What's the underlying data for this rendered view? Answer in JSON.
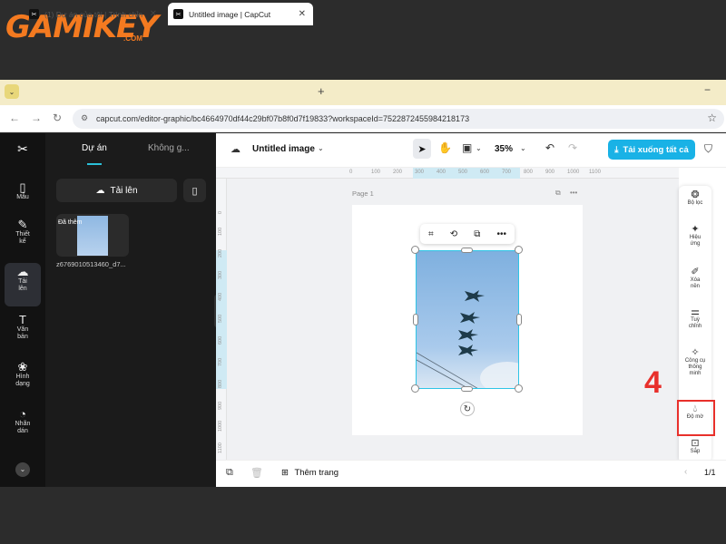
{
  "logo": {
    "text": "GAMIKEY",
    "suffix": ".COM"
  },
  "browser": {
    "tabs": [
      {
        "label": "(1) Dự án của tôi | Trình chỉn",
        "favicon": "CapCut"
      },
      {
        "label": "Untitled image | CapCut",
        "favicon": "CapCut"
      }
    ],
    "url": "capcut.com/editor-graphic/bc4664970df44c29bf07b8f0d7f19833?workspaceId=7522872455984218173"
  },
  "rail": {
    "items": [
      {
        "label": "Mẫu",
        "icon": "template-icon"
      },
      {
        "label": "Thiết kế",
        "icon": "design-icon"
      },
      {
        "label": "Tải lên",
        "icon": "upload-icon"
      },
      {
        "label": "Văn bản",
        "icon": "text-icon"
      },
      {
        "label": "Hình dạng",
        "icon": "shape-icon"
      },
      {
        "label": "Nhãn dán",
        "icon": "sticker-icon"
      }
    ]
  },
  "panel": {
    "tab_active": "Dự án",
    "tab_other": "Không g...",
    "upload_label": "Tải lên",
    "asset": {
      "tag": "Đã thêm",
      "name": "z6769010513460_d7..."
    }
  },
  "toolbar": {
    "title": "Untitled image",
    "zoom": "35%",
    "download_label": "Tải xuống tất cả"
  },
  "ruler": {
    "h_ticks": [
      "0",
      "100",
      "200",
      "300",
      "400",
      "500",
      "600",
      "700",
      "800",
      "900",
      "1000",
      "1100"
    ],
    "v_ticks": [
      "0",
      "100",
      "200",
      "300",
      "400",
      "500",
      "600",
      "700",
      "800",
      "900",
      "1000",
      "1100"
    ]
  },
  "canvas": {
    "page_label": "Page 1"
  },
  "right_panel": {
    "items": [
      {
        "label": "Bộ lọc",
        "icon": "filter-icon"
      },
      {
        "label": "Hiệu ứng",
        "icon": "effects-icon"
      },
      {
        "label": "Xóa nền",
        "icon": "remove-bg-icon"
      },
      {
        "label": "Tuỳ chỉnh",
        "icon": "adjust-icon"
      },
      {
        "label": "Công cụ thông minh",
        "icon": "smart-tools-icon"
      },
      {
        "label": "Độ mờ",
        "icon": "opacity-icon"
      },
      {
        "label": "Sắp",
        "icon": "arrange-icon"
      }
    ]
  },
  "annotation": {
    "step": "4",
    "color": "#e8302b"
  },
  "bottom": {
    "add_page": "Thêm trang",
    "page_count": "1/1"
  },
  "colors": {
    "accent": "#19b2e6",
    "selection": "#2ec4e6",
    "logo": "#f47a20"
  }
}
